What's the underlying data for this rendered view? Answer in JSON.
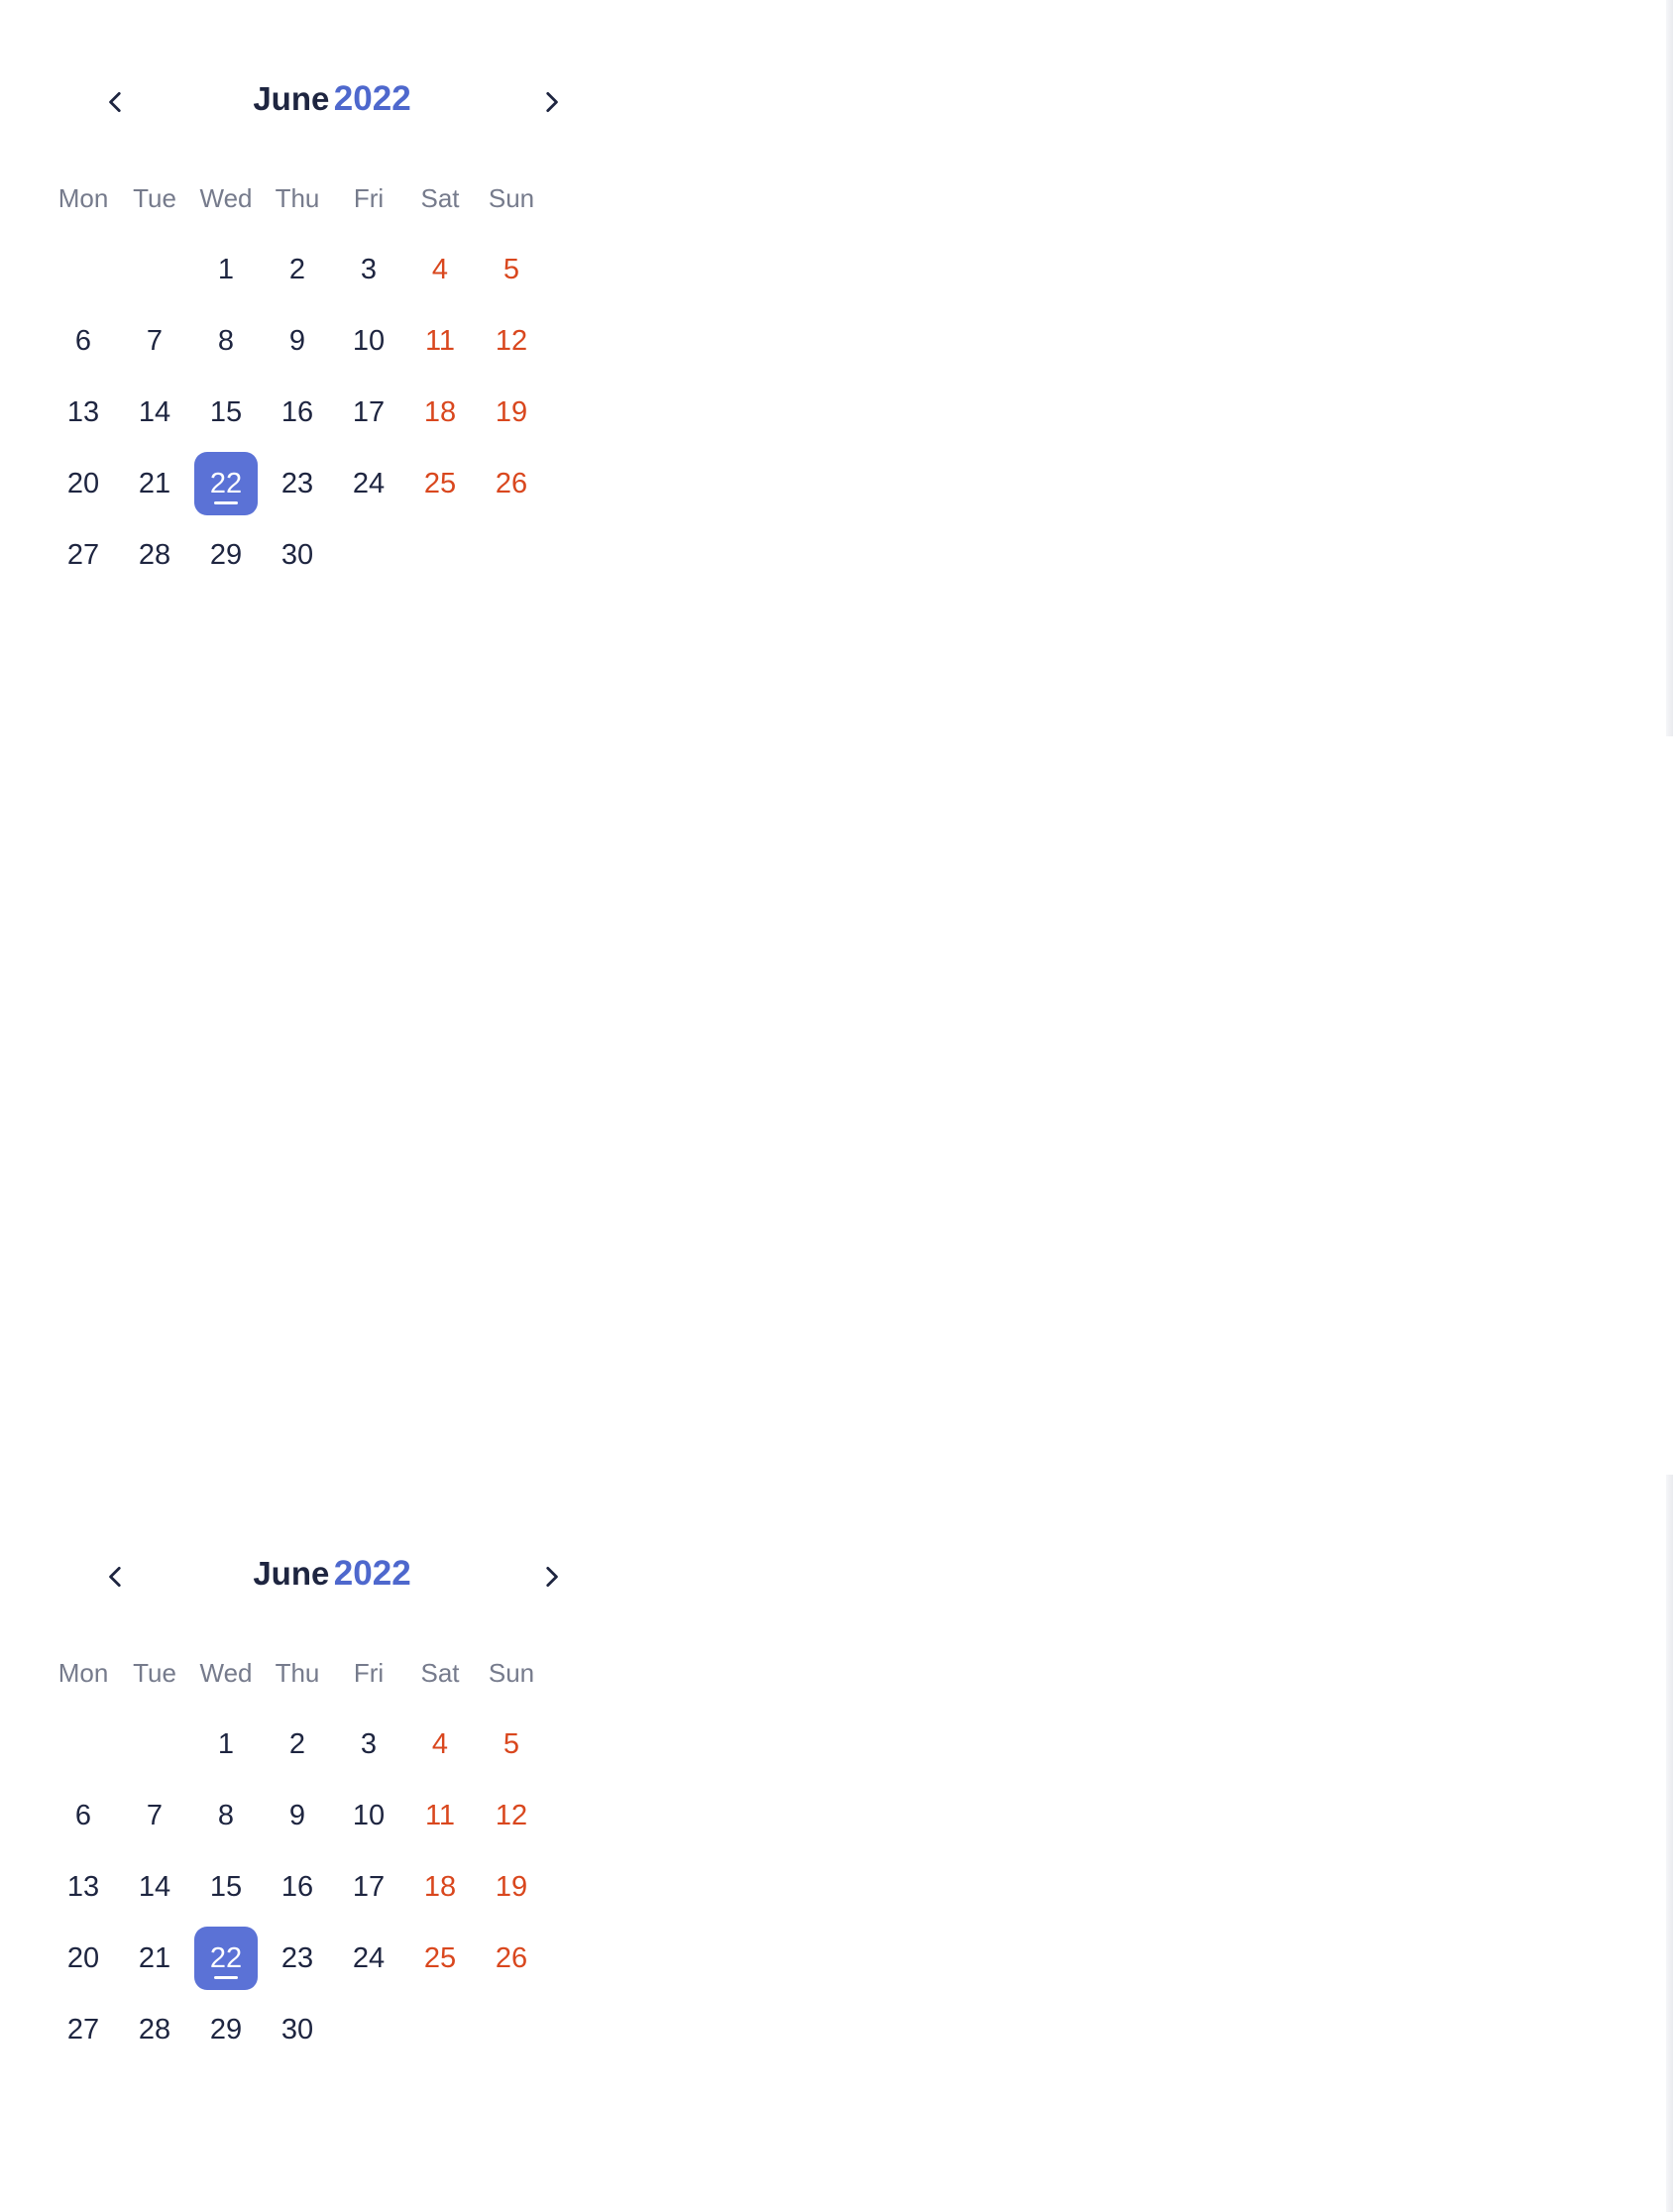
{
  "calendar": {
    "month": "June",
    "year": "2022",
    "weekdays": [
      "Mon",
      "Tue",
      "Wed",
      "Thu",
      "Fri",
      "Sat",
      "Sun"
    ],
    "weeks": [
      [
        "",
        "",
        "1",
        "2",
        "3",
        "4",
        "5"
      ],
      [
        "6",
        "7",
        "8",
        "9",
        "10",
        "11",
        "12"
      ],
      [
        "13",
        "14",
        "15",
        "16",
        "17",
        "18",
        "19"
      ],
      [
        "20",
        "21",
        "22",
        "23",
        "24",
        "25",
        "26"
      ],
      [
        "27",
        "28",
        "29",
        "30",
        "",
        "",
        ""
      ]
    ],
    "selected_day": "22"
  },
  "colors": {
    "accent": "#5b72d6",
    "year": "#4e68cd",
    "weekend": "#d9471e",
    "text": "#1e2540",
    "weekday_header": "#767b8c",
    "heatmap": "#ff0000"
  },
  "icons": {
    "prev": "chevron-left-icon",
    "next": "chevron-right-icon"
  }
}
